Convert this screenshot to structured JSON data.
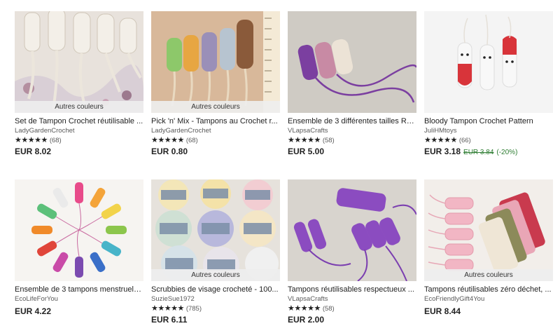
{
  "listings": [
    {
      "title": "Set de Tampon Crochet réutilisable ...",
      "shop": "LadyGardenCrochet",
      "stars": "★★★★★",
      "reviews": "(68)",
      "price": "EUR 8.02",
      "badge": "Autres couleurs",
      "image_icon": "crochet-tampon-set-photo"
    },
    {
      "title": "Pick 'n' Mix - Tampons au Crochet r...",
      "shop": "LadyGardenCrochet",
      "stars": "★★★★★",
      "reviews": "(68)",
      "price": "EUR 0.80",
      "badge": "Autres couleurs",
      "image_icon": "crochet-tampons-multicolor-photo"
    },
    {
      "title": "Ensemble de 3 différentes tailles Ré...",
      "shop": "VLapsaCrafts",
      "stars": "★★★★★",
      "reviews": "(58)",
      "price": "EUR 5.00",
      "image_icon": "crochet-tampons-three-sizes-photo"
    },
    {
      "title": "Bloody Tampon Crochet Pattern",
      "shop": "JuliHMtoys",
      "stars": "★★★★★",
      "reviews": "(66)",
      "price": "EUR 3.18",
      "original_price": "EUR 3.84",
      "discount": "(-20%)",
      "image_icon": "amigurumi-tampons-photo"
    },
    {
      "title": "Ensemble de 3 tampons menstruels...",
      "shop": "EcoLifeForYou",
      "price": "EUR 4.22",
      "image_icon": "crochet-tampons-circle-photo"
    },
    {
      "title": "Scrubbies de visage crocheté - 100...",
      "shop": "SuzieSue1972",
      "stars": "★★★★★",
      "reviews": "(785)",
      "price": "EUR 6.11",
      "badge": "Autres couleurs",
      "image_icon": "face-scrubbies-photo"
    },
    {
      "title": "Tampons réutilisables respectueux ...",
      "shop": "VLapsaCrafts",
      "stars": "★★★★★",
      "reviews": "(58)",
      "price": "EUR 2.00",
      "image_icon": "purple-crochet-tampons-photo"
    },
    {
      "title": "Tampons réutilisables zéro déchet, ...",
      "shop": "EcoFriendlyGift4You",
      "price": "EUR 8.44",
      "badge": "Autres couleurs",
      "image_icon": "pink-crochet-tampons-photo"
    }
  ],
  "colors": {
    "text": "#222222",
    "muted": "#595959",
    "discount": "#2e7d32",
    "badge_bg": "#eeeeee"
  }
}
